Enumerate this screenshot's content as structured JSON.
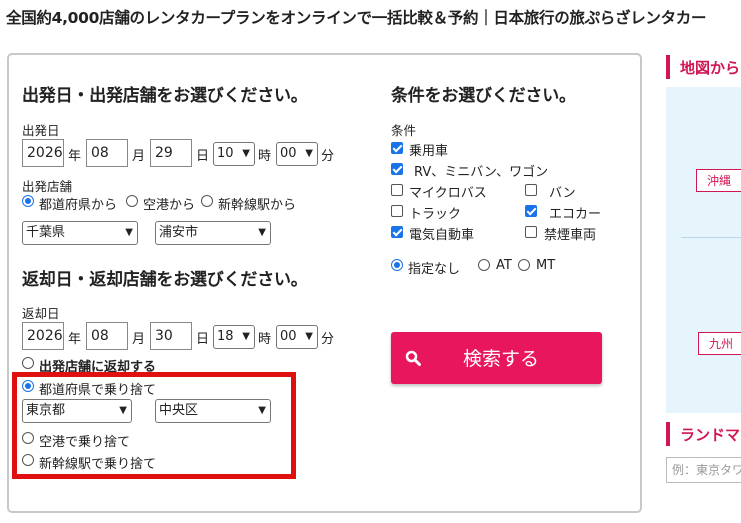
{
  "page_title": "全国約4,000店舗のレンタカープランをオンラインで一括比較＆予約｜日本旅行の旅ぷらざレンタカー",
  "departure": {
    "heading": "出発日・出発店舗をお選びください。",
    "date_label": "出発日",
    "year": "2026",
    "year_unit": "年",
    "month": "08",
    "month_unit": "月",
    "day": "29",
    "day_unit": "日",
    "hour": "10",
    "hour_unit": "時",
    "minute": "00",
    "minute_unit": "分",
    "store_label": "出発店舗",
    "store_options": [
      "都道府県から",
      "空港から",
      "新幹線駅から"
    ],
    "prefecture": "千葉県",
    "city": "浦安市"
  },
  "return": {
    "heading": "返却日・返却店舗をお選びください。",
    "date_label": "返却日",
    "year": "2026",
    "year_unit": "年",
    "month": "08",
    "month_unit": "月",
    "day": "30",
    "day_unit": "日",
    "hour": "18",
    "hour_unit": "時",
    "minute": "00",
    "minute_unit": "分",
    "same_store": "出発店舗に返却する",
    "drop_prefecture": "都道府県で乗り捨て",
    "prefecture": "東京都",
    "city": "中央区",
    "drop_airport": "空港で乗り捨て",
    "drop_shinkansen": "新幹線駅で乗り捨て"
  },
  "conditions": {
    "heading": "条件をお選びください。",
    "label": "条件",
    "car_types": [
      {
        "label": "乗用車",
        "checked": true
      },
      {
        "label": "RV、ミニバン、ワゴン",
        "checked": true
      },
      {
        "label": "マイクロバス",
        "checked": false
      },
      {
        "label": "バン",
        "checked": false
      },
      {
        "label": "トラック",
        "checked": false
      },
      {
        "label": "エコカー",
        "checked": true
      },
      {
        "label": "電気自動車",
        "checked": true
      },
      {
        "label": "禁煙車両",
        "checked": false
      }
    ],
    "transmission": [
      "指定なし",
      "AT",
      "MT"
    ]
  },
  "search_button": "検索する",
  "sidebar": {
    "map_heading": "地図から",
    "map_labels": [
      "沖縄",
      "九州"
    ],
    "landmark_heading": "ランドマ",
    "landmark_placeholder": "例：東京タワ"
  },
  "colors": {
    "accent": "#e8165c",
    "highlight": "#e01010",
    "map_bg": "#e6f4fb"
  }
}
